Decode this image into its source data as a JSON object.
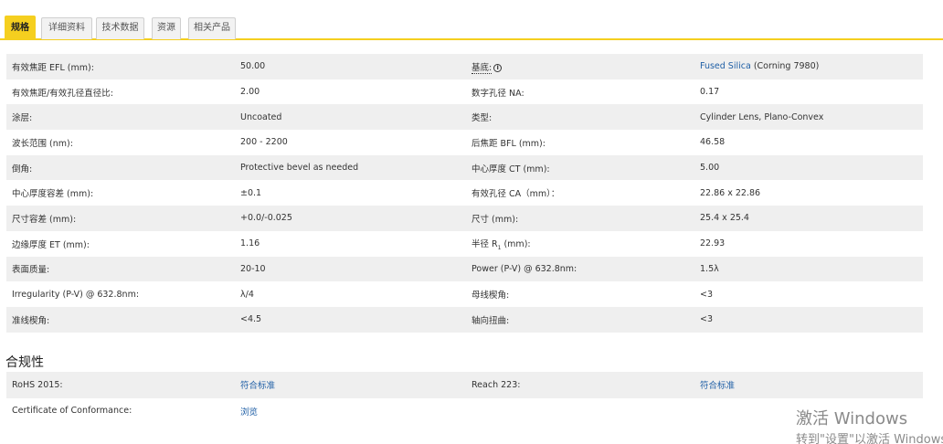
{
  "tabs": [
    "规格",
    "详细资料",
    "技术数据",
    "资源",
    "相关产品"
  ],
  "specs": [
    {
      "l1": "有效焦距 EFL (mm):",
      "v1": "50.00",
      "l2": "基底:",
      "v2_link": "Fused Silica",
      "v2_rest": " (Corning 7980)"
    },
    {
      "l1": "有效焦距/有效孔径直径比:",
      "v1": "2.00",
      "l2": "数字孔径 NA:",
      "v2": "0.17"
    },
    {
      "l1": "涂层:",
      "v1": "Uncoated",
      "l2": "类型:",
      "v2": "Cylinder Lens, Plano-Convex"
    },
    {
      "l1": "波长范围 (nm):",
      "v1": "200 - 2200",
      "l2": "后焦距 BFL (mm):",
      "v2": "46.58"
    },
    {
      "l1": "倒角:",
      "v1": "Protective bevel as needed",
      "l2": "中心厚度 CT (mm):",
      "v2": "5.00"
    },
    {
      "l1": "中心厚度容差 (mm):",
      "v1": "±0.1",
      "l2": "有效孔径 CA（mm）：",
      "v2": "22.86 x 22.86"
    },
    {
      "l1": "尺寸容差 (mm):",
      "v1": "+0.0/-0.025",
      "l2": "尺寸 (mm):",
      "v2": "25.4 x 25.4"
    },
    {
      "l1": "边缘厚度 ET (mm):",
      "v1": "1.16",
      "l2a": "半径 R",
      "l2sub": "1",
      "l2b": " (mm):",
      "v2": "22.93"
    },
    {
      "l1": "表面质量:",
      "v1": "20-10",
      "l2": "Power (P-V) @ 632.8nm:",
      "v2": "1.5λ"
    },
    {
      "l1": "Irregularity (P-V) @ 632.8nm:",
      "v1": "λ/4",
      "l2": "母线楔角:",
      "v2": "<3"
    },
    {
      "l1": "准线楔角:",
      "v1": "<4.5",
      "l2": "轴向扭曲:",
      "v2": "<3"
    }
  ],
  "compliance": {
    "title": "合规性",
    "rows": [
      {
        "l1": "RoHS 2015:",
        "v1": "符合标准",
        "l2": "Reach 223:",
        "v2": "符合标准"
      },
      {
        "l1": "Certificate of Conformance:",
        "v1": "浏览"
      }
    ]
  },
  "watermark": {
    "line1": "激活 Windows",
    "line2": "转到\"设置\"以激活 Windows。"
  },
  "colors": {
    "accent": "#f5cf1f",
    "link": "#1f5fa6",
    "row_shade": "#efefef"
  }
}
